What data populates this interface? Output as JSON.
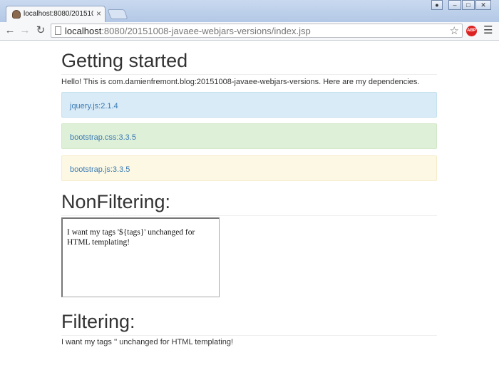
{
  "browser": {
    "tab_title": "localhost:8080/20151008-",
    "tab_close": "×",
    "url_host": "localhost",
    "url_rest": ":8080/20151008-javaee-webjars-versions/index.jsp",
    "abp_label": "ABP"
  },
  "page": {
    "heading_getting_started": "Getting started",
    "intro_text": "Hello! This is com.damienfremont.blog:20151008-javaee-webjars-versions. Here are my dependencies.",
    "dependencies": [
      {
        "label": "jquery.js:2.1.4",
        "style": "info"
      },
      {
        "label": "bootstrap.css:3.3.5",
        "style": "success"
      },
      {
        "label": "bootstrap.js:3.3.5",
        "style": "warning"
      }
    ],
    "heading_nonfiltering": "NonFiltering:",
    "textarea_value": "I want my tags '${tags}' unchanged for HTML templating!",
    "heading_filtering": "Filtering:",
    "filtering_text": "I want my tags '' unchanged for HTML templating!"
  },
  "colors": {
    "alert_info_bg": "#d9ebf6",
    "alert_success_bg": "#dff0d8",
    "alert_warning_bg": "#fcf8e3",
    "link_text": "#3a7ab4"
  },
  "icons": [
    "user-icon",
    "minimize-icon",
    "maximize-icon",
    "close-icon",
    "back-arrow-icon",
    "forward-arrow-icon",
    "reload-icon",
    "page-icon",
    "star-icon",
    "adblock-icon",
    "menu-icon"
  ]
}
